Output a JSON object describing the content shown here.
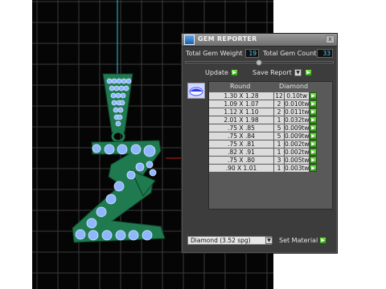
{
  "viewport": {
    "grid_color": "#3a3a3a",
    "background": "#050505",
    "pendant_color": "#1f7a4f",
    "gem_color": "#8fb7ff"
  },
  "panel": {
    "title": "GEM REPORTER",
    "close_glyph": "x",
    "total_weight_label": "Total Gem Weight",
    "total_weight_value": "19",
    "total_count_label": "Total Gem Count",
    "total_count_value": "33",
    "update_label": "Update",
    "save_report_label": "Save Report",
    "table": {
      "headers": [
        "Round",
        "Diamond"
      ],
      "rows": [
        {
          "size": "1.30 X 1.28",
          "count": "12",
          "tw": "0.10tw"
        },
        {
          "size": "1.09 X 1.07",
          "count": "2",
          "tw": "0.010tw"
        },
        {
          "size": "1.12 X 1.10",
          "count": "2",
          "tw": "0.011tw"
        },
        {
          "size": "2.01 X 1.98",
          "count": "1",
          "tw": "0.032tw"
        },
        {
          "size": ".75 X .85",
          "count": "5",
          "tw": "0.009tw"
        },
        {
          "size": ".75 X .84",
          "count": "5",
          "tw": "0.009tw"
        },
        {
          "size": ".75 X .81",
          "count": "1",
          "tw": "0.002tw"
        },
        {
          "size": ".82 X .91",
          "count": "1",
          "tw": "0.002tw"
        },
        {
          "size": ".75 X .80",
          "count": "3",
          "tw": "0.005tw"
        },
        {
          "size": ".90 X 1.01",
          "count": "1",
          "tw": "0.003tw"
        }
      ]
    },
    "material_value": "Diamond   (3.52 spg)",
    "set_material_label": "Set Material",
    "accent_green": "#4cc02a"
  }
}
